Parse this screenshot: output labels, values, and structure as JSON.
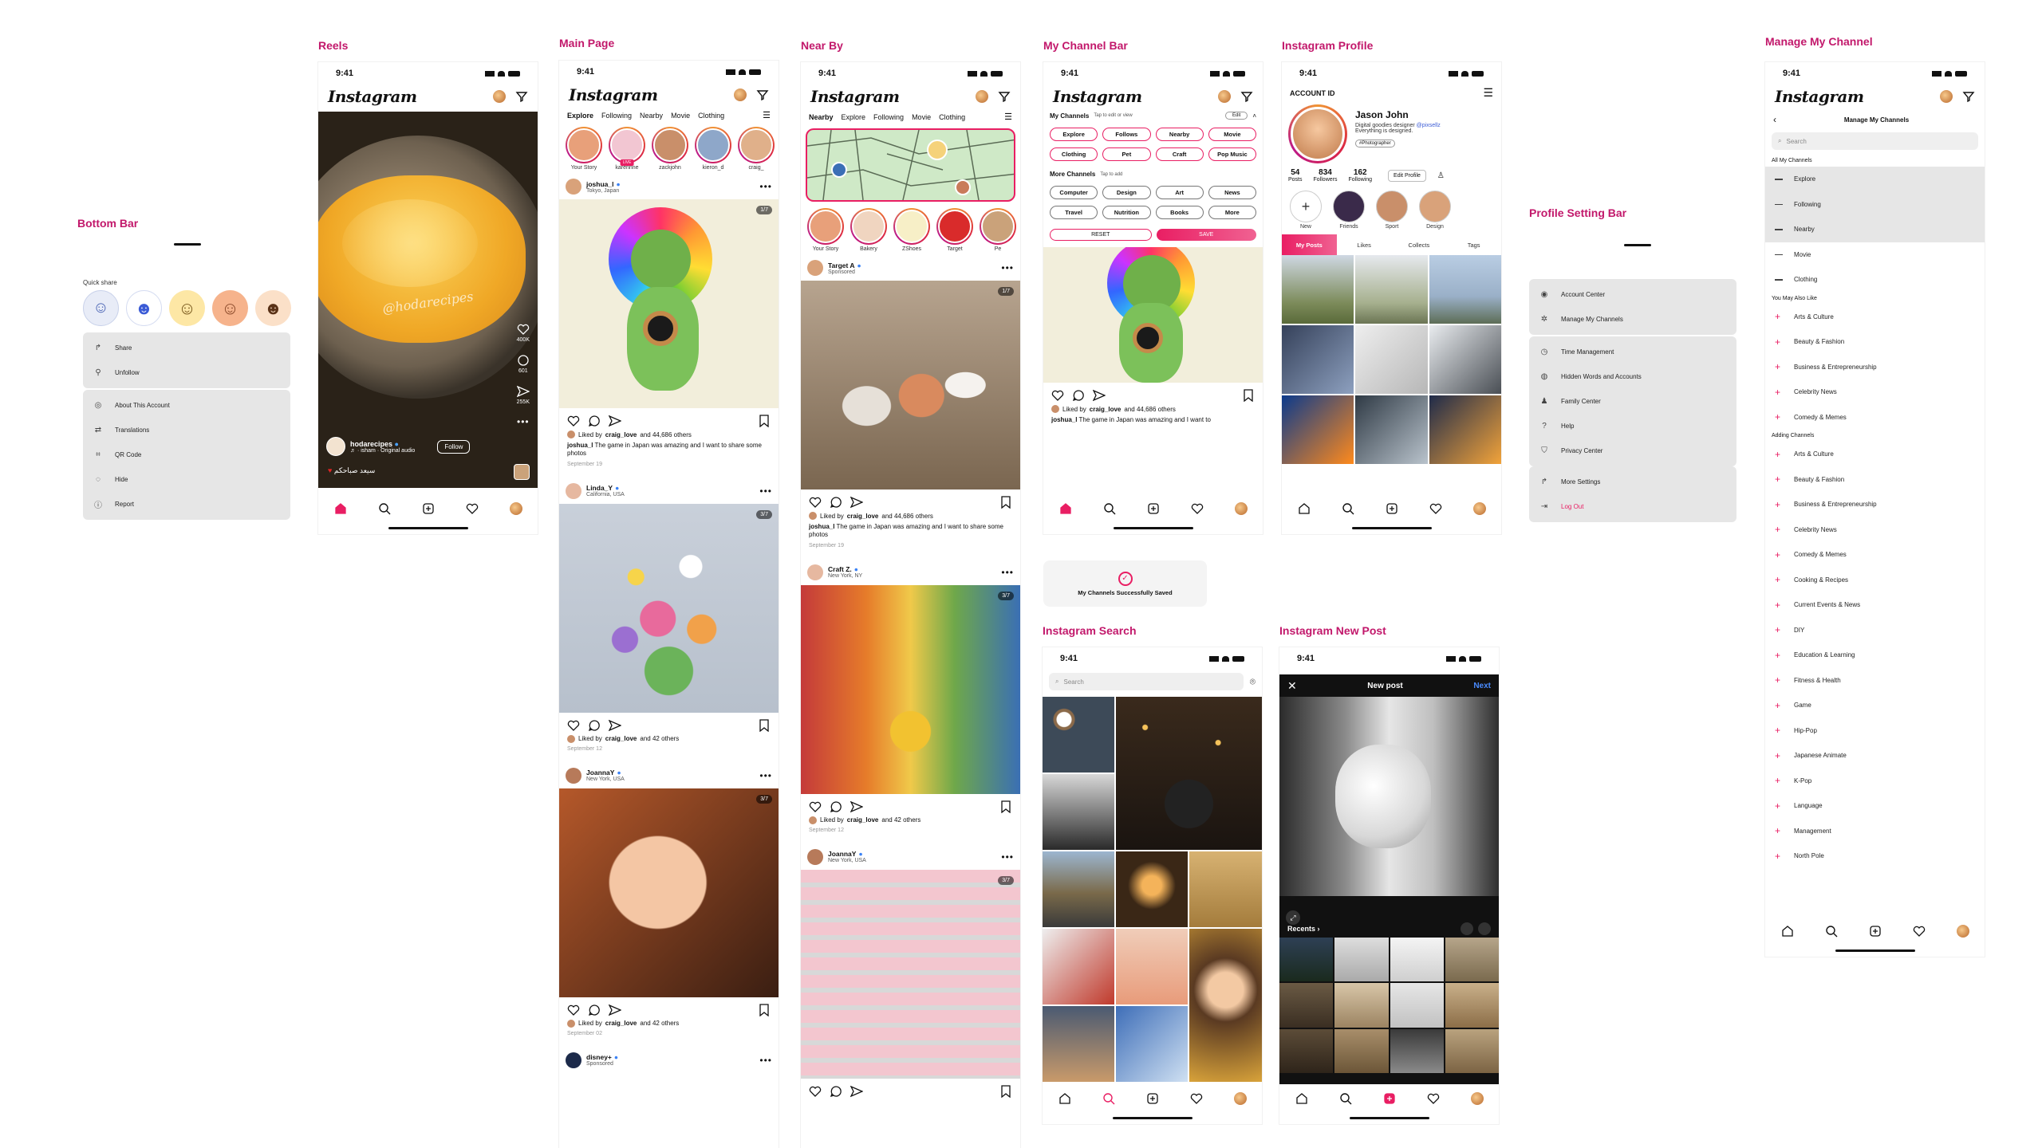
{
  "sections": {
    "bottom_bar": "Bottom Bar",
    "reels": "Reels",
    "main_page": "Main Page",
    "near_by": "Near By",
    "my_channel_bar": "My Channel Bar",
    "instagram_profile": "Instagram Profile",
    "profile_setting_bar": "Profile Setting Bar",
    "manage_my_channel": "Manage My Channel",
    "instagram_search": "Instagram Search",
    "instagram_new_post": "Instagram New Post"
  },
  "status": {
    "time": "9:41"
  },
  "app": {
    "logo": "Instagram"
  },
  "bottom_bar": {
    "quick_share": "Quick share",
    "group1": [
      {
        "icon": "share-icon",
        "label": "Share"
      },
      {
        "icon": "unfollow-icon",
        "label": "Unfollow"
      }
    ],
    "group2": [
      {
        "icon": "account-icon",
        "label": "About This Account"
      },
      {
        "icon": "translate-icon",
        "label": "Translations"
      },
      {
        "icon": "qr-icon",
        "label": "QR Code"
      },
      {
        "icon": "hide-icon",
        "label": "Hide"
      },
      {
        "icon": "report-icon",
        "label": "Report"
      }
    ]
  },
  "reels": {
    "overlay_text": "@hodarecipes",
    "likes": "400K",
    "comments": "601",
    "shares": "255K",
    "user": "hodarecipes",
    "audio": "♬ · isham · Original audio",
    "follow": "Follow",
    "caption": "سيعد صباحكم"
  },
  "main_tabs": [
    "Explore",
    "Following",
    "Nearby",
    "Movie",
    "Clothing"
  ],
  "near_tabs": [
    "Nearby",
    "Explore",
    "Following",
    "Movie",
    "Clothing"
  ],
  "main_stories": [
    {
      "name": "Your Story",
      "badge": ""
    },
    {
      "name": "karennne",
      "badge": "LIVE"
    },
    {
      "name": "zackjohn",
      "badge": ""
    },
    {
      "name": "kieron_d",
      "badge": ""
    },
    {
      "name": "craig_",
      "badge": ""
    }
  ],
  "near_stories": [
    "Your Story",
    "Bakery",
    "ZShoes",
    "Target",
    "Pe"
  ],
  "main_posts": [
    {
      "user": "joshua_l",
      "loc": "Tokyo, Japan",
      "count": "1/7",
      "liked": "craig_love",
      "others": "and 44,686 others",
      "caption_user": "joshua_l",
      "caption": "The game in Japan was amazing and I want to share some photos",
      "date": "September 19"
    },
    {
      "user": "Linda_Y",
      "loc": "California, USA",
      "count": "3/7",
      "liked": "craig_love",
      "others": "and 42 others",
      "date": "September 12"
    },
    {
      "user": "JoannaY",
      "loc": "New York, USA",
      "count": "3/7",
      "liked": "craig_love",
      "others": "and 42 others",
      "date": "September 02"
    },
    {
      "user": "disney+",
      "loc": "Sponsored"
    }
  ],
  "near_posts": [
    {
      "user": "Target A",
      "loc": "Sponsored",
      "count": "1/7",
      "liked": "craig_love",
      "others": "and 44,686 others",
      "caption_user": "joshua_l",
      "caption": "The game in Japan was amazing and I want to share some photos",
      "date": "September 19"
    },
    {
      "user": "Craft Z.",
      "loc": "New York, NY",
      "count": "3/7",
      "liked": "craig_love",
      "others": "and 42 others",
      "date": "September 12"
    },
    {
      "user": "JoannaY",
      "loc": "New York, USA",
      "count": "3/7"
    }
  ],
  "channels": {
    "title": "My Channels",
    "hint": "Tap to edit or view",
    "edit": "Edit",
    "mine": [
      "Explore",
      "Follows",
      "Nearby",
      "Movie",
      "Clothing",
      "Pet",
      "Craft",
      "Pop Music"
    ],
    "more_title": "More Channels",
    "more_hint": "Tap to add",
    "more": [
      "Computer",
      "Design",
      "Art",
      "News",
      "Travel",
      "Nutrition",
      "Books",
      "More"
    ],
    "reset": "RESET",
    "save": "SAVE",
    "liked": "craig_love",
    "others": "and 44,686 others",
    "caption_user": "joshua_l",
    "caption": "The game in Japan was amazing and I want to",
    "saved_toast": "My Channels Successfully Saved"
  },
  "profile": {
    "account_id": "ACCOUNT ID",
    "name": "Jason John",
    "bio1": "Digital goodies designer",
    "handle": "@pixsellz",
    "bio2": "Everything is designed.",
    "tag": "#Photographer",
    "stats": [
      {
        "n": "54",
        "l": "Posts"
      },
      {
        "n": "834",
        "l": "Followers"
      },
      {
        "n": "162",
        "l": "Following"
      }
    ],
    "edit": "Edit Profile",
    "highlights": [
      "New",
      "Friends",
      "Sport",
      "Design"
    ],
    "tabs": [
      "My Posts",
      "Likes",
      "Collects",
      "Tags"
    ]
  },
  "settings": {
    "group1": [
      {
        "icon": "account-center-icon",
        "label": "Account Center"
      },
      {
        "icon": "manage-channels-icon",
        "label": "Manage My Channels"
      }
    ],
    "group2": [
      {
        "icon": "time-icon",
        "label": "Time Management"
      },
      {
        "icon": "hidden-words-icon",
        "label": "Hidden Words and Accounts"
      },
      {
        "icon": "family-icon",
        "label": "Family Center"
      },
      {
        "icon": "help-icon",
        "label": "Help"
      },
      {
        "icon": "privacy-icon",
        "label": "Privacy Center"
      }
    ],
    "group3": [
      {
        "icon": "more-settings-icon",
        "label": "More Settings"
      },
      {
        "icon": "logout-icon",
        "label": "Log Out"
      }
    ]
  },
  "manage": {
    "title": "Manage My Channels",
    "search": "Search",
    "all_title": "All My Channels",
    "all": [
      "Explore",
      "Following",
      "Nearby",
      "Movie",
      "Clothing"
    ],
    "like_title": "You May Also Like",
    "like": [
      "Arts & Culture",
      "Beauty & Fashion",
      "Business & Entrepreneurship",
      "Celebrity News",
      "Comedy & Memes"
    ],
    "adding_title": "Adding Channels",
    "adding": [
      "Arts & Culture",
      "Beauty & Fashion",
      "Business & Entrepreneurship",
      "Celebrity News",
      "Comedy & Memes",
      "Cooking & Recipes",
      "Current Events & News",
      "DIY",
      "Education & Learning",
      "Fitness & Health",
      "Game",
      "Hip-Pop",
      "Japanese Animate",
      "K-Pop",
      "Language",
      "Management",
      "North Pole"
    ]
  },
  "search": {
    "placeholder": "Search"
  },
  "newpost": {
    "title": "New post",
    "next": "Next",
    "recents": "Recents"
  },
  "colors": {
    "accent": "#e91e63",
    "section": "#c2186b",
    "menu_bg": "#e6e6e6"
  }
}
